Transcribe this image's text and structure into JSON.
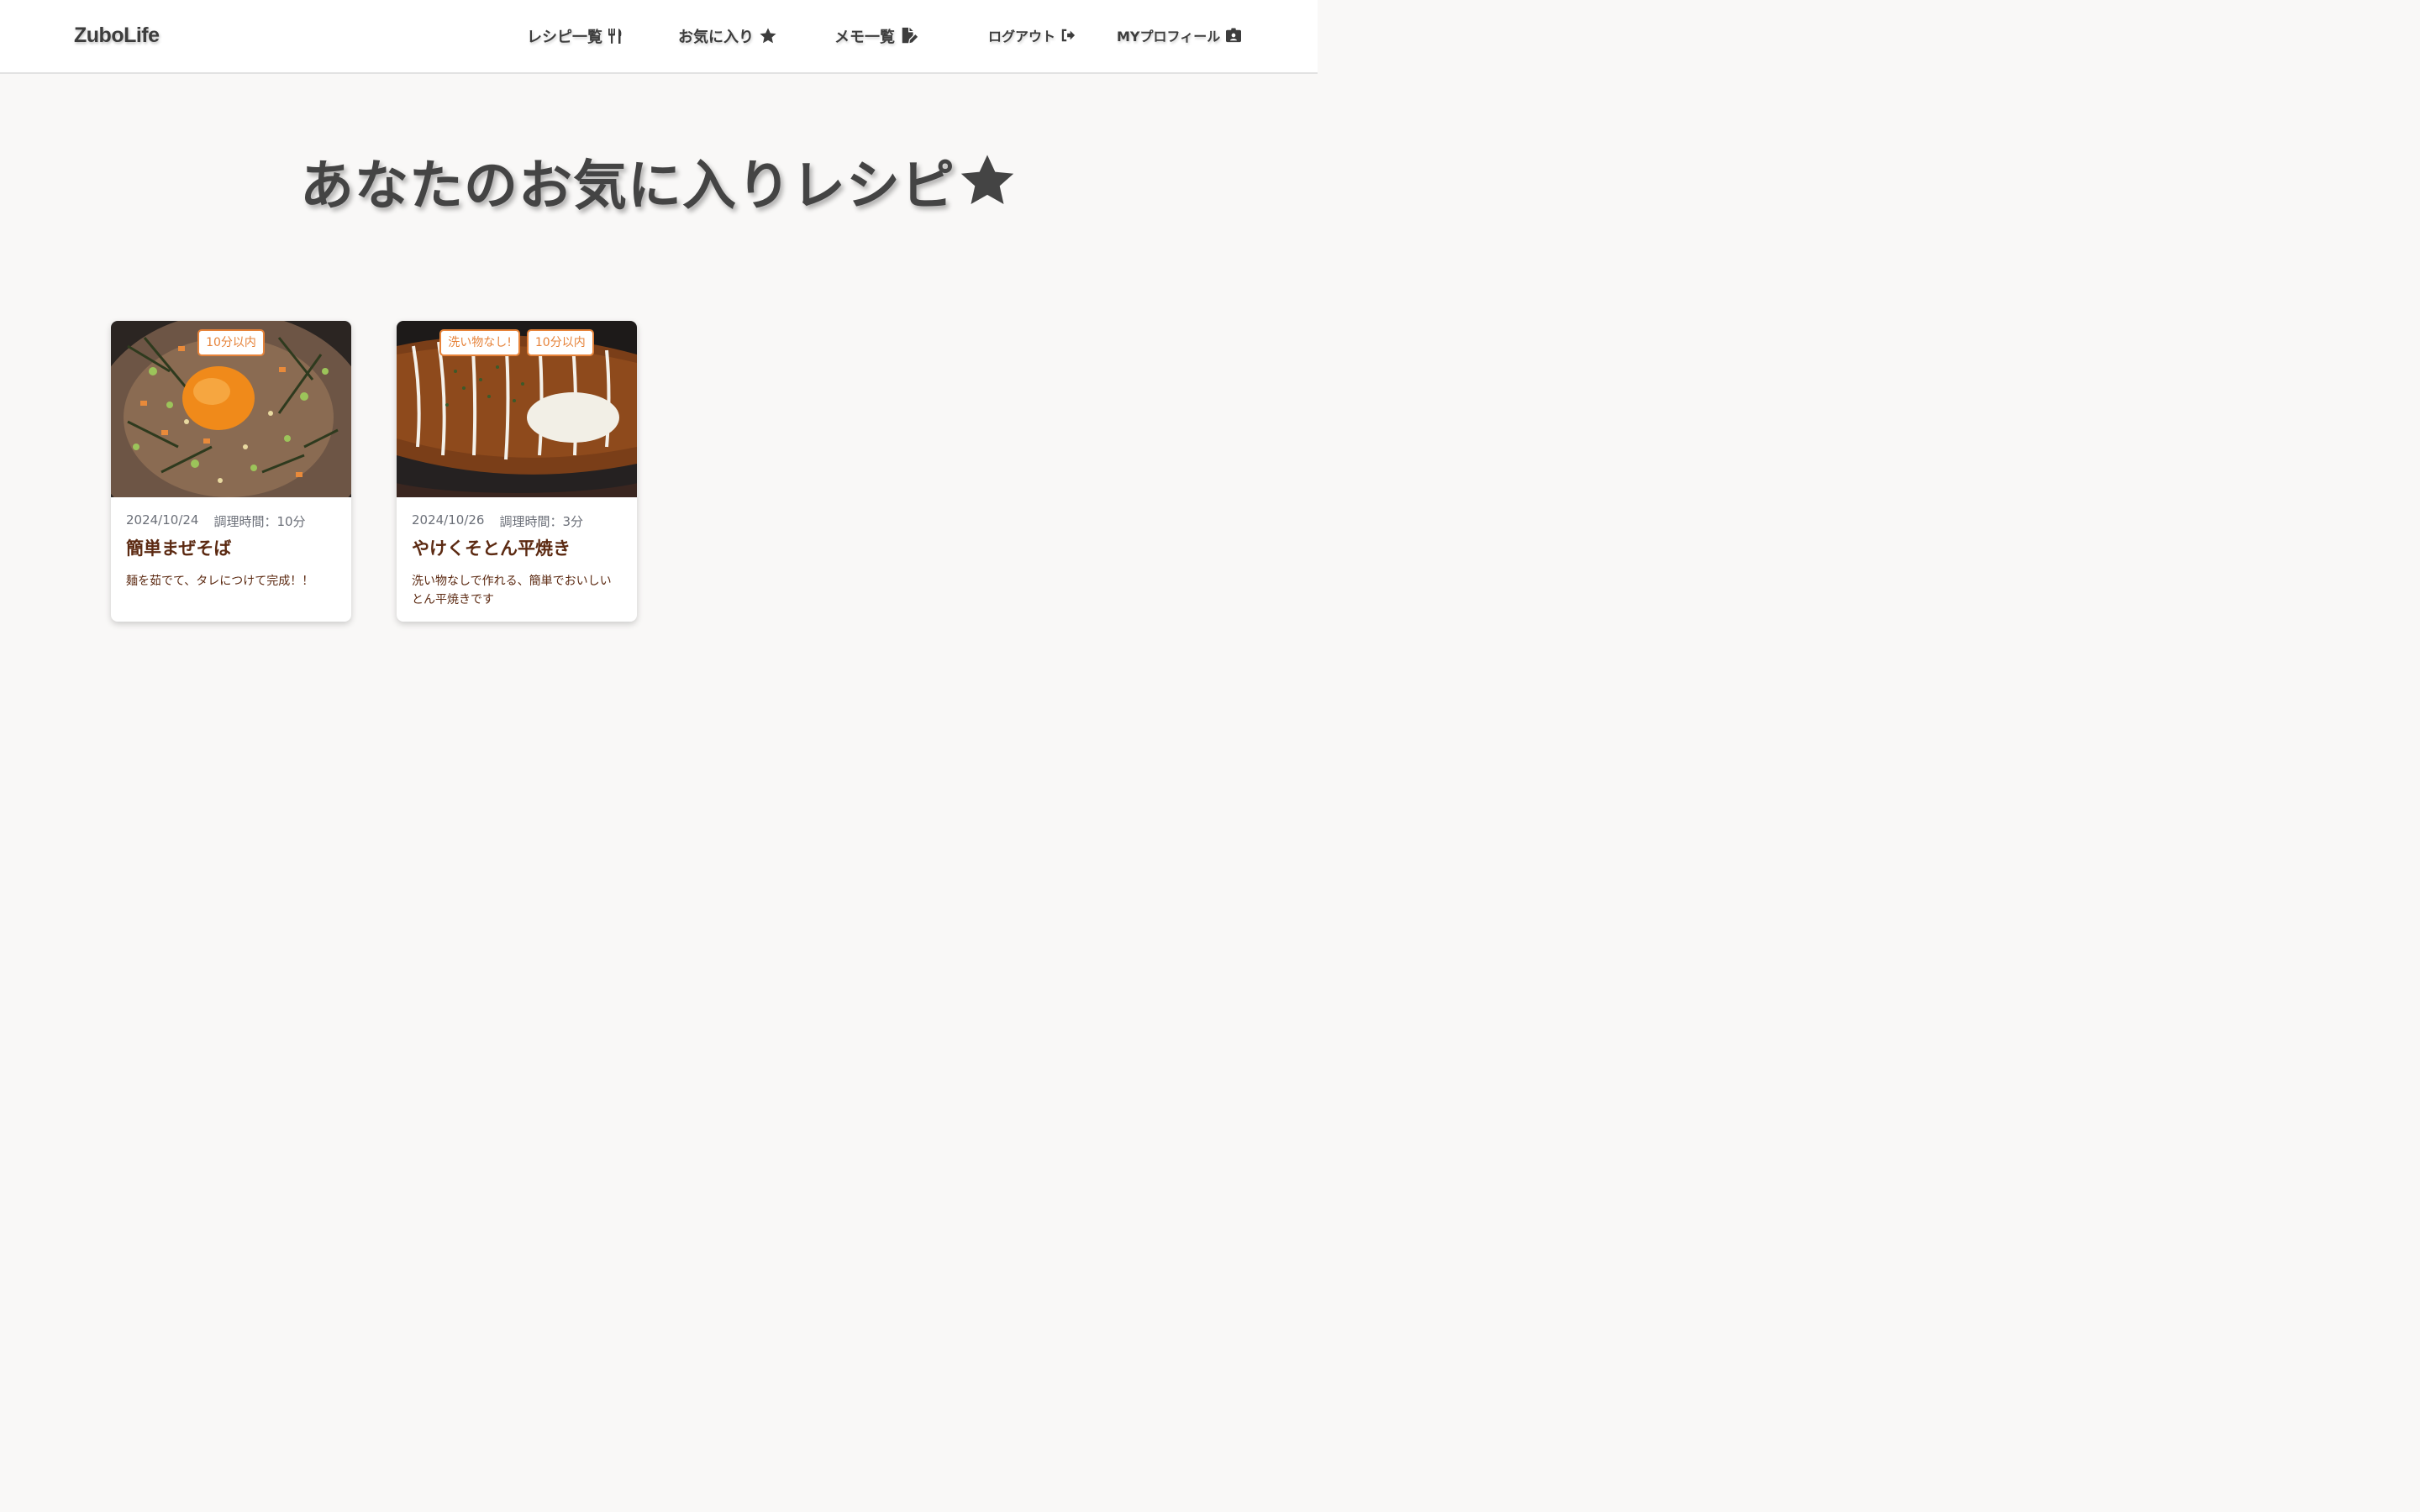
{
  "nav": {
    "brand": "ZuboLife",
    "recipes": "レシピ一覧",
    "favorites": "お気に入り",
    "memos": "メモ一覧",
    "logout": "ログアウト",
    "profile": "MYプロフィール"
  },
  "page": {
    "title": "あなたのお気に入りレシピ"
  },
  "colors": {
    "accent": "#e6833a",
    "title_brown": "#5c2a12",
    "background": "#f9f8f7"
  },
  "recipes": [
    {
      "tags": [
        "10分以内"
      ],
      "date": "2024/10/24",
      "cook_time": "調理時間：10分",
      "title": "簡単まぜそば",
      "description": "麺を茹でて、タレにつけて完成！！"
    },
    {
      "tags": [
        "洗い物なし!",
        "10分以内"
      ],
      "date": "2024/10/26",
      "cook_time": "調理時間：3分",
      "title": "やけくそとん平焼き",
      "description": "洗い物なしで作れる、簡単でおいしいとん平焼きです"
    }
  ]
}
